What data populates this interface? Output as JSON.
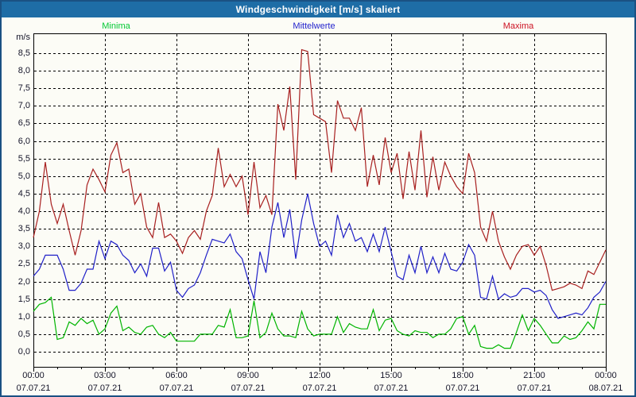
{
  "window": {
    "title": "Windgeschwindigkeit [m/s] skaliert"
  },
  "colors": {
    "titlebar_bg": "#1e6da6",
    "titlebar_text": "#ffffff",
    "window_border": "#1a5183",
    "content_bg": "#fcfcf6",
    "grid": "#000000",
    "axis_text": "#141428",
    "minima_text": "#00c832",
    "mittelwerte_text": "#2323cd",
    "maxima_text": "#cc1122"
  },
  "legend": [
    {
      "label": "Minima",
      "color": "#00c832",
      "x": 144
    },
    {
      "label": "Mittelwerte",
      "color": "#2323cd",
      "x": 393
    },
    {
      "label": "Maxima",
      "color": "#cc1122",
      "x": 650
    }
  ],
  "chart_data": {
    "type": "line",
    "title": "Windgeschwindigkeit [m/s] skaliert",
    "ylabel": "m/s",
    "xlabel": "",
    "grid": "dashed",
    "legend_position": "top",
    "ylim": [
      -0.45,
      9.05
    ],
    "y_ticks": [
      8.5,
      8.0,
      7.5,
      7.0,
      6.5,
      6.0,
      5.5,
      5.0,
      4.5,
      4.0,
      3.5,
      3.0,
      2.5,
      2.0,
      1.5,
      1.0,
      0.5,
      0.0
    ],
    "y_tick_labels": [
      "8,5",
      "8,0",
      "7,5",
      "7,0",
      "6,5",
      "6,0",
      "5,5",
      "5,0",
      "4,5",
      "4,0",
      "3,5",
      "3,0",
      "2,5",
      "2,0",
      "1,5",
      "1,0",
      "0,5",
      "0,0"
    ],
    "x_hours_range": [
      0,
      24
    ],
    "x_interval_minutes": 15,
    "x_minor_tick_hours": 1,
    "x_major_ticks": [
      {
        "hour": 0,
        "time": "00:00",
        "date": "07.07.21"
      },
      {
        "hour": 3,
        "time": "03:00",
        "date": "07.07.21"
      },
      {
        "hour": 6,
        "time": "06:00",
        "date": "07.07.21"
      },
      {
        "hour": 9,
        "time": "09:00",
        "date": "07.07.21"
      },
      {
        "hour": 12,
        "time": "12:00",
        "date": "07.07.21"
      },
      {
        "hour": 15,
        "time": "15:00",
        "date": "07.07.21"
      },
      {
        "hour": 18,
        "time": "18:00",
        "date": "07.07.21"
      },
      {
        "hour": 21,
        "time": "21:00",
        "date": "07.07.21"
      },
      {
        "hour": 24,
        "time": "00:00",
        "date": "08.07.21"
      }
    ],
    "series": [
      {
        "name": "Minima",
        "color": "#00b400",
        "values": [
          1.15,
          1.35,
          1.4,
          1.55,
          0.35,
          0.4,
          0.85,
          0.75,
          0.95,
          0.8,
          0.9,
          0.5,
          0.65,
          1.1,
          1.3,
          0.6,
          0.7,
          0.55,
          0.5,
          0.7,
          0.75,
          0.5,
          0.4,
          0.55,
          0.3,
          0.3,
          0.3,
          0.3,
          0.5,
          0.5,
          0.5,
          0.75,
          0.7,
          1.2,
          0.4,
          0.4,
          0.45,
          1.45,
          0.4,
          0.55,
          1.1,
          0.65,
          0.45,
          0.45,
          0.4,
          1.15,
          0.65,
          0.45,
          0.5,
          0.5,
          0.5,
          1.0,
          0.55,
          0.8,
          0.7,
          0.65,
          0.65,
          1.2,
          0.6,
          0.9,
          0.95,
          0.6,
          0.5,
          0.45,
          0.6,
          0.55,
          0.55,
          0.4,
          0.5,
          0.5,
          0.65,
          0.95,
          1.0,
          0.5,
          0.75,
          0.15,
          0.1,
          0.1,
          0.2,
          0.1,
          0.1,
          0.55,
          1.05,
          0.6,
          0.95,
          0.75,
          0.5,
          0.25,
          0.25,
          0.45,
          0.35,
          0.4,
          0.6,
          0.85,
          0.65,
          1.35,
          1.35
        ]
      },
      {
        "name": "Mittelwerte",
        "color": "#2020c8",
        "values": [
          2.15,
          2.35,
          2.75,
          2.75,
          2.75,
          2.35,
          1.75,
          1.75,
          1.95,
          2.35,
          2.35,
          3.15,
          2.65,
          3.15,
          3.05,
          2.75,
          2.6,
          2.25,
          2.5,
          2.15,
          2.95,
          2.95,
          2.3,
          2.55,
          1.75,
          1.55,
          1.8,
          1.9,
          2.25,
          2.75,
          3.2,
          3.15,
          3.1,
          3.35,
          2.85,
          2.65,
          2.05,
          1.5,
          2.85,
          2.25,
          3.55,
          4.25,
          3.25,
          4.05,
          2.65,
          3.75,
          4.5,
          3.65,
          3.0,
          3.15,
          2.75,
          3.9,
          3.25,
          3.65,
          3.15,
          3.25,
          2.85,
          3.35,
          2.85,
          3.55,
          2.85,
          2.15,
          2.05,
          2.75,
          2.25,
          3.0,
          2.25,
          2.7,
          2.25,
          2.8,
          2.35,
          2.3,
          2.55,
          3.05,
          2.75,
          1.55,
          1.5,
          2.15,
          1.5,
          1.65,
          1.55,
          1.6,
          1.8,
          1.8,
          1.7,
          1.75,
          1.6,
          1.2,
          0.95,
          1.0,
          1.05,
          1.1,
          1.05,
          1.25,
          1.55,
          1.7,
          2.0
        ]
      },
      {
        "name": "Maxima",
        "color": "#a82020",
        "values": [
          3.25,
          4.0,
          5.4,
          4.2,
          3.65,
          4.2,
          3.45,
          2.75,
          3.45,
          4.75,
          5.2,
          4.9,
          4.55,
          5.6,
          5.95,
          5.1,
          5.2,
          4.2,
          4.5,
          3.55,
          3.25,
          4.25,
          3.25,
          3.35,
          3.15,
          2.8,
          3.25,
          3.45,
          3.2,
          4.0,
          4.45,
          5.8,
          4.7,
          5.05,
          4.7,
          5.0,
          3.9,
          5.4,
          4.1,
          4.45,
          3.9,
          7.05,
          6.3,
          7.55,
          4.9,
          8.6,
          8.55,
          6.75,
          6.65,
          6.55,
          5.1,
          7.15,
          6.65,
          6.65,
          6.3,
          6.95,
          4.7,
          5.6,
          4.75,
          6.1,
          5.1,
          5.65,
          4.35,
          5.7,
          4.6,
          6.3,
          4.4,
          5.55,
          4.6,
          5.4,
          5.0,
          4.7,
          4.5,
          5.65,
          5.1,
          3.55,
          3.15,
          4.0,
          3.15,
          2.7,
          2.35,
          2.75,
          3.0,
          3.05,
          2.75,
          3.0,
          2.45,
          1.75,
          1.8,
          1.85,
          1.95,
          1.9,
          1.8,
          2.3,
          2.2,
          2.55,
          2.9
        ]
      }
    ]
  }
}
